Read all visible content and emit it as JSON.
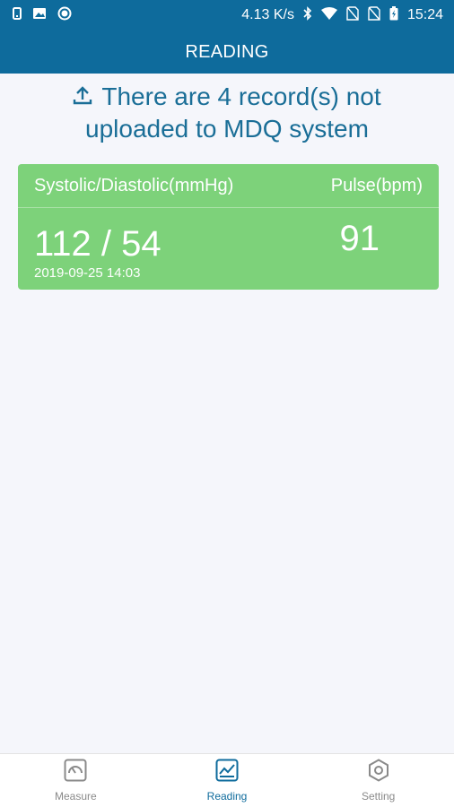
{
  "status_bar": {
    "network_speed": "4.13 K/s",
    "time": "15:24"
  },
  "app_bar": {
    "title": "READING"
  },
  "upload_banner": {
    "line1": "There are 4 record(s) not",
    "line2": "uploaded to MDQ system",
    "icon": "upload-icon"
  },
  "reading_card": {
    "bp_header": "Systolic/Diastolic(mmHg)",
    "pulse_header": "Pulse(bpm)",
    "bp_value": "112 / 54",
    "pulse_value": "91",
    "timestamp": "2019-09-25 14:03",
    "color": "#7dd27a"
  },
  "bottom_nav": {
    "items": [
      {
        "label": "Measure",
        "icon": "gauge-icon",
        "active": false
      },
      {
        "label": "Reading",
        "icon": "chart-icon",
        "active": true
      },
      {
        "label": "Setting",
        "icon": "settings-icon",
        "active": false
      }
    ]
  },
  "colors": {
    "primary": "#0e6b9c",
    "background": "#f5f6fb",
    "inactive": "#8a8a8a"
  }
}
